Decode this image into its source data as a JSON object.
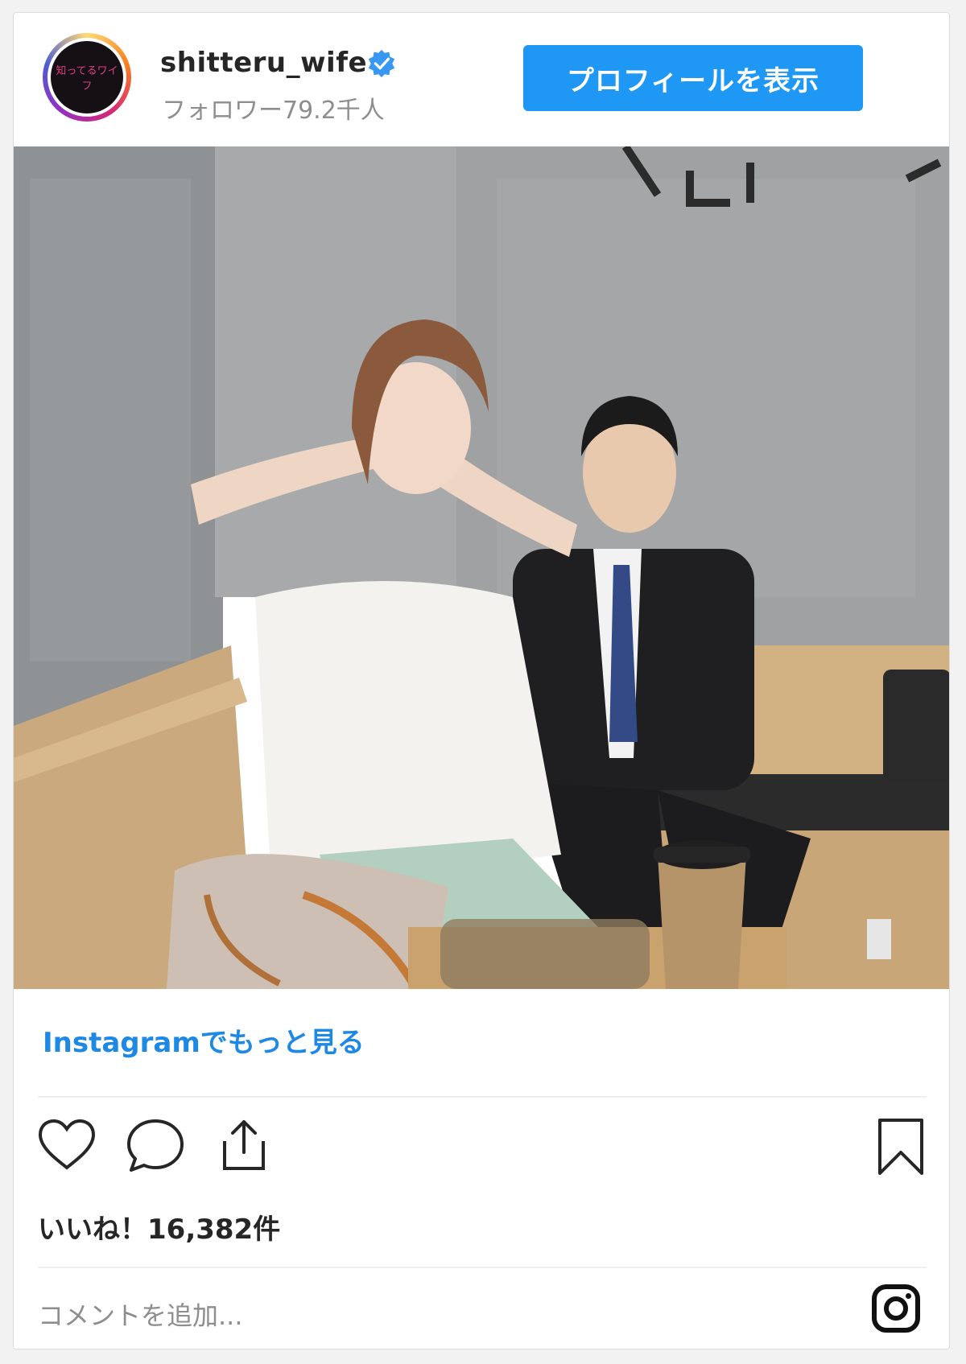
{
  "account": {
    "username": "shitteru_wife",
    "followers": "フォロワー79.2千人",
    "avatar_text": "知ってるワイフ"
  },
  "header": {
    "profile_button": "プロフィールを表示"
  },
  "post": {
    "more_link": "Instagramでもっと見る",
    "likes": "いいね！16,382件",
    "comment_placeholder": "コメントを追加..."
  },
  "icons": {
    "verified": "verified-badge-icon",
    "like": "heart-icon",
    "comment": "comment-bubble-icon",
    "share": "share-upload-icon",
    "save": "bookmark-icon",
    "logo": "instagram-logo-icon"
  },
  "colors": {
    "accent": "#1e98f4",
    "link": "#1e88e5",
    "text": "#262626",
    "muted": "#8e8e8e"
  }
}
